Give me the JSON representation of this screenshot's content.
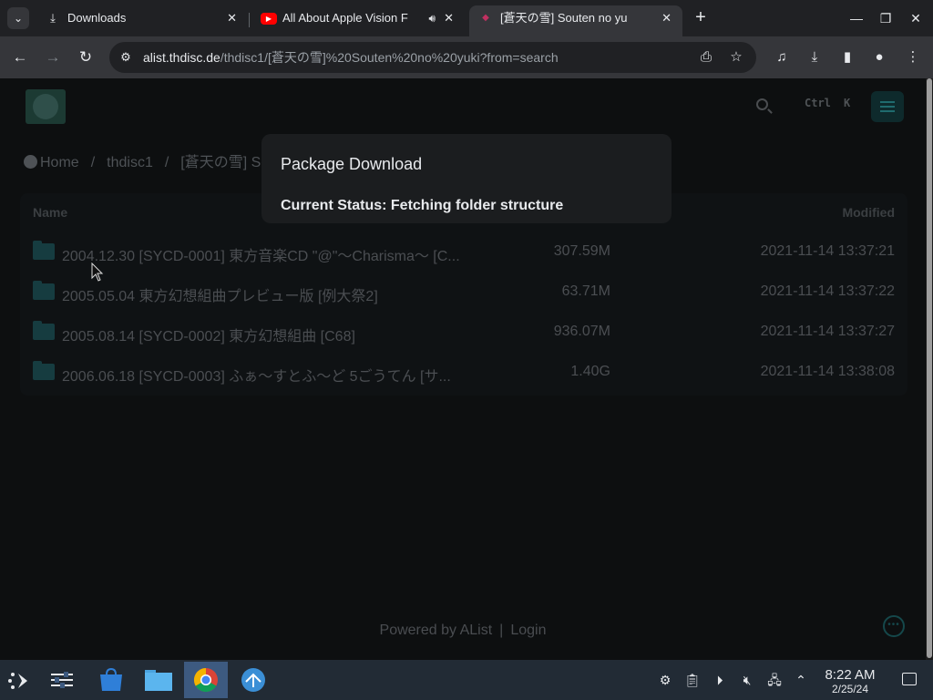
{
  "browser": {
    "tabs": [
      {
        "title": "Downloads",
        "favicon": "download-icon"
      },
      {
        "title": "All About Apple Vision F",
        "favicon": "youtube-icon",
        "audio": true
      },
      {
        "title": "[蒼天の雪] Souten no yuki |",
        "favicon": "alist-icon",
        "active": true
      }
    ],
    "url_host": "alist.thdisc.de",
    "url_path": "/thdisc1/[蒼天の雪]%20Souten%20no%20yuki?from=search"
  },
  "header": {
    "kbd_ctrl": "Ctrl",
    "kbd_k": "K"
  },
  "breadcrumb": {
    "home": "Home",
    "sep": "/",
    "crumb1": "thdisc1",
    "crumb2": "[蒼天の雪] So"
  },
  "filelist": {
    "columns": {
      "name": "Name",
      "modified": "Modified"
    },
    "rows": [
      {
        "name": "2004.12.30 [SYCD-0001] 東方音楽CD \"@\"〜Charisma〜 [C...",
        "size": "307.59M",
        "modified": "2021-11-14 13:37:21"
      },
      {
        "name": "2005.05.04 東方幻想組曲プレビュー版 [例大祭2]",
        "size": "63.71M",
        "modified": "2021-11-14 13:37:22"
      },
      {
        "name": "2005.08.14 [SYCD-0002] 東方幻想組曲 [C68]",
        "size": "936.07M",
        "modified": "2021-11-14 13:37:27"
      },
      {
        "name": "2006.06.18 [SYCD-0003] ふぁ〜すとふ〜ど 5ごうてん [サ...",
        "size": "1.40G",
        "modified": "2021-11-14 13:38:08"
      }
    ]
  },
  "dialog": {
    "title": "Package Download",
    "status": "Current Status: Fetching folder structure"
  },
  "footer": {
    "powered": "Powered by AList",
    "sep": "|",
    "login": "Login"
  },
  "taskbar": {
    "time": "8:22 AM",
    "date": "2/25/24"
  },
  "colors": {
    "page_bg": "#0d0f10",
    "accent": "#1f6b6e",
    "taskbar_bg": "#222b35",
    "chrome_bg": "#202124"
  }
}
